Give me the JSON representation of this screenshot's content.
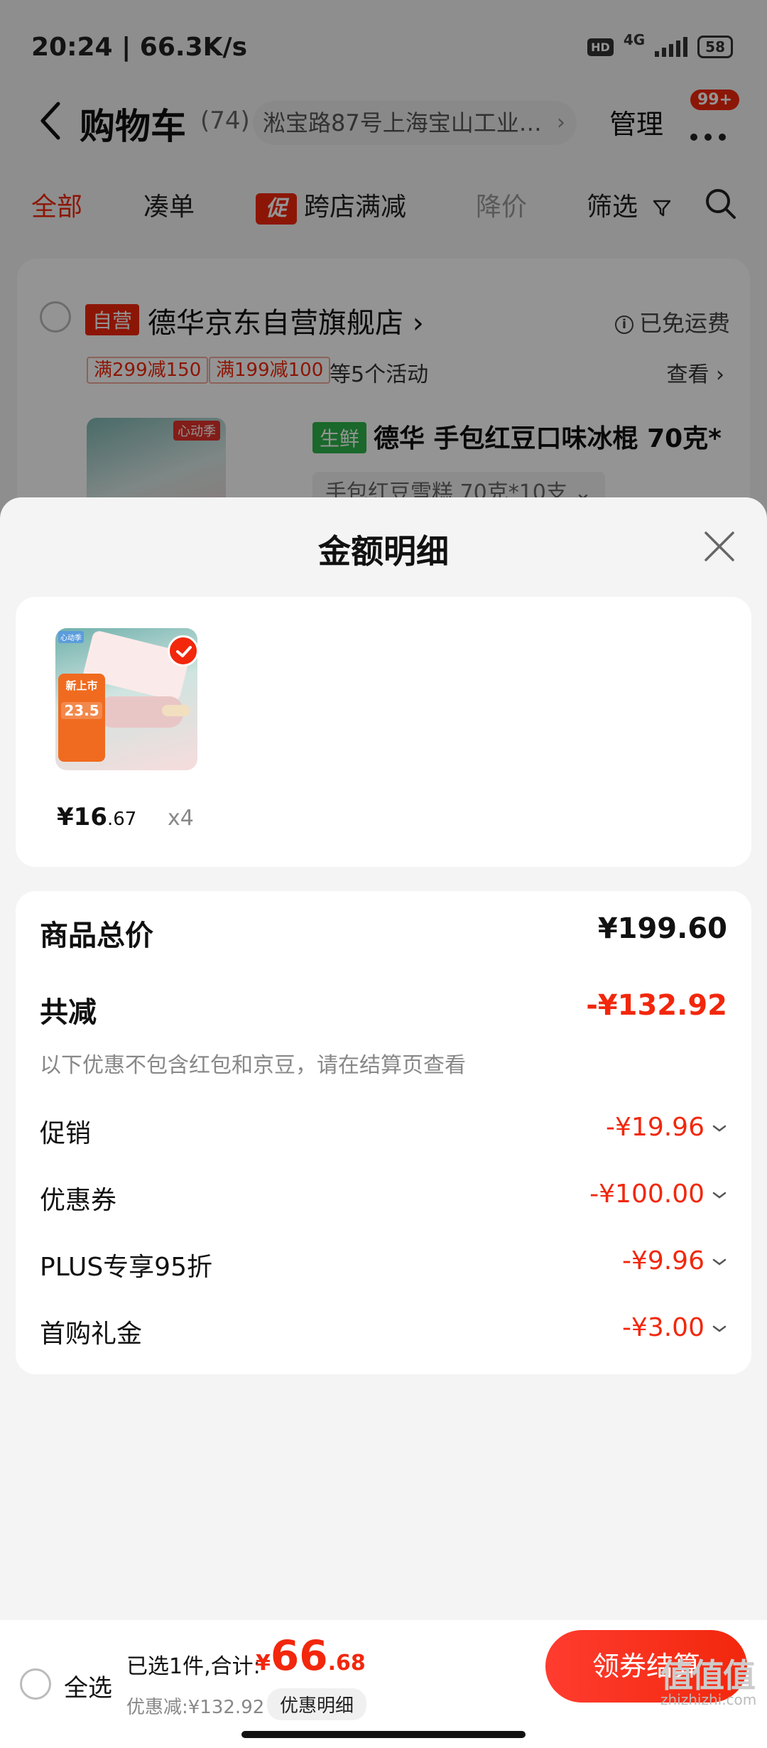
{
  "status": {
    "time_speed": "20:24 | 66.3K/s",
    "hd": "HD",
    "network": "4G",
    "battery": "58"
  },
  "header": {
    "title": "购物车",
    "count": "(74)",
    "address": "淞宝路87号上海宝山工业…",
    "manage": "管理",
    "badge": "99+"
  },
  "tabs": {
    "all": "全部",
    "bundle": "凑单",
    "promo_badge": "促",
    "cross_store": "跨店满减",
    "price_drop": "降价",
    "filter": "筛选"
  },
  "store": {
    "self_tag": "自营",
    "name": "德华京东自营旗舰店 ›",
    "free_shipping": "已免运费",
    "coupons": [
      "满299减150",
      "满199减100"
    ],
    "activities": "等5个活动",
    "view": "查看 ›",
    "thumb_tag": "心动季",
    "fresh_tag": "生鲜",
    "product_title": "德华 手包红豆口味冰棍 70克*",
    "product_spec": "手包红豆雪糕 70克*10支 ⌄"
  },
  "sheet": {
    "title": "金额明细",
    "item": {
      "price_int": "¥16",
      "price_dec": ".67",
      "qty": "x4",
      "thumb_new": "新上市",
      "thumb_price": "23.5"
    },
    "summary": {
      "total_label": "商品总价",
      "total_value": "¥199.60",
      "reduce_label": "共减",
      "reduce_value": "-¥132.92",
      "note": "以下优惠不包含红包和京豆，请在结算页查看",
      "rows": [
        {
          "label": "促销",
          "value": "-¥19.96"
        },
        {
          "label": "优惠券",
          "value": "-¥100.00"
        },
        {
          "label": "PLUS专享95折",
          "value": "-¥9.96"
        },
        {
          "label": "首购礼金",
          "value": "-¥3.00"
        }
      ]
    }
  },
  "bottom": {
    "select_all": "全选",
    "selected": "已选1件,合计:",
    "total_symbol": "¥",
    "total_int": "66",
    "total_dec": ".68",
    "discount": "优惠减:¥132.92",
    "detail": "优惠明细",
    "checkout": "领券结算"
  },
  "watermark": {
    "logo": "值值值",
    "url": "zhizhizhi.com"
  },
  "colors": {
    "accent": "#f2270c",
    "fresh_green": "#2eb34a"
  }
}
